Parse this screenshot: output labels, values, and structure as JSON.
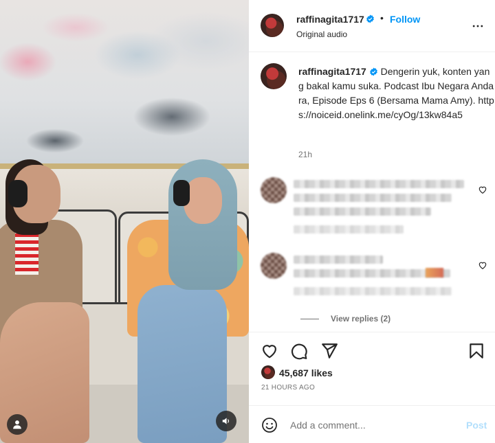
{
  "post": {
    "username": "raffinagita1717",
    "follow_label": "Follow",
    "separator": "•",
    "audio": "Original audio",
    "more_icon": "more-horizontal-icon"
  },
  "caption": {
    "username": "raffinagita1717",
    "text": "Dengerin yuk, konten yang bakal kamu suka. Podcast Ibu Negara Andara, Episode Eps 6 (Bersama Mama Amy). https://noiceid.onelink.me/cyOg/13kw84a5",
    "time": "21h"
  },
  "comments": {
    "view_replies": "View replies (2)"
  },
  "actions": {
    "like_icon": "heart-icon",
    "comment_icon": "comment-icon",
    "share_icon": "paper-plane-icon",
    "save_icon": "bookmark-icon"
  },
  "stats": {
    "likes": "45,687 likes",
    "posted": "21 HOURS AGO"
  },
  "composer": {
    "placeholder": "Add a comment...",
    "post_label": "Post"
  },
  "colors": {
    "accent": "#0095f6",
    "post_disabled": "#b2dffc",
    "text": "#262626",
    "muted": "#737373"
  }
}
